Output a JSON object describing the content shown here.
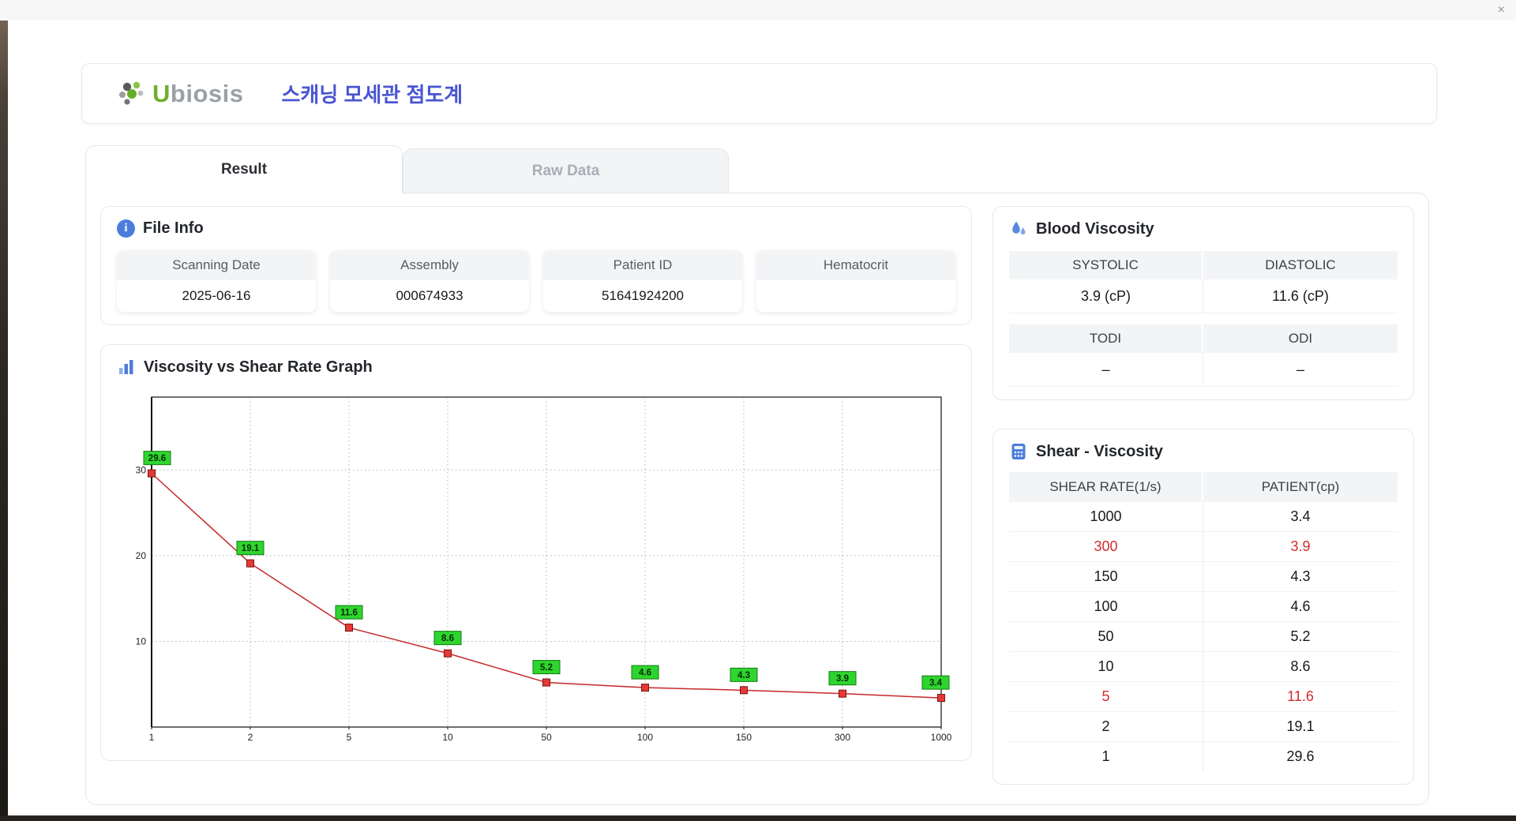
{
  "window": {
    "close_glyph": "×"
  },
  "header": {
    "brand_u": "U",
    "brand_rest": "biosis",
    "title": "스캐닝 모세관 점도계"
  },
  "tabs": [
    {
      "label": "Result",
      "active": true
    },
    {
      "label": "Raw Data",
      "active": false
    }
  ],
  "icons": {
    "info_glyph": "i"
  },
  "colors": {
    "accent_blue": "#4c7ddb",
    "title_blue": "#4a55d2",
    "brand_green": "#6faf2f",
    "highlight_red": "#d22c2c",
    "header_gray": "#f3f4f6"
  },
  "file_info": {
    "heading": "File Info",
    "fields": [
      {
        "label": "Scanning Date",
        "value": "2025-06-16"
      },
      {
        "label": "Assembly",
        "value": "000674933"
      },
      {
        "label": "Patient ID",
        "value": "51641924200"
      },
      {
        "label": "Hematocrit",
        "value": ""
      }
    ]
  },
  "blood_viscosity": {
    "heading": "Blood Viscosity",
    "rows": [
      {
        "cells": [
          {
            "label": "SYSTOLIC",
            "value": "3.9 (cP)"
          },
          {
            "label": "DIASTOLIC",
            "value": "11.6 (cP)"
          }
        ]
      },
      {
        "cells": [
          {
            "label": "TODI",
            "value": "–"
          },
          {
            "label": "ODI",
            "value": "–"
          }
        ]
      }
    ]
  },
  "graph": {
    "heading": "Viscosity vs Shear Rate Graph"
  },
  "chart_data": {
    "type": "line",
    "title": "",
    "xlabel": "",
    "ylabel": "",
    "categories": [
      "1",
      "2",
      "5",
      "10",
      "50",
      "100",
      "150",
      "300",
      "1000"
    ],
    "values": [
      29.6,
      19.1,
      11.6,
      8.6,
      5.2,
      4.6,
      4.3,
      3.9,
      3.4
    ],
    "ylim": [
      0,
      38.5
    ],
    "yticks": [
      10,
      20,
      30
    ],
    "x_scale": "category",
    "grid": "dotted",
    "legend": "none",
    "line_color": "#c62828",
    "marker": "square",
    "marker_color": "#e53935",
    "marker_edge": "#7a1212",
    "label_bg": "#2ed52e",
    "label_edge": "#157a15",
    "label_text": "#062c06"
  },
  "shear_viscosity": {
    "heading": "Shear - Viscosity",
    "columns": [
      "SHEAR RATE(1/s)",
      "PATIENT(cp)"
    ],
    "rows": [
      {
        "shear": "1000",
        "patient": "3.4",
        "highlight": false
      },
      {
        "shear": "300",
        "patient": "3.9",
        "highlight": true
      },
      {
        "shear": "150",
        "patient": "4.3",
        "highlight": false
      },
      {
        "shear": "100",
        "patient": "4.6",
        "highlight": false
      },
      {
        "shear": "50",
        "patient": "5.2",
        "highlight": false
      },
      {
        "shear": "10",
        "patient": "8.6",
        "highlight": false
      },
      {
        "shear": "5",
        "patient": "11.6",
        "highlight": true
      },
      {
        "shear": "2",
        "patient": "19.1",
        "highlight": false
      },
      {
        "shear": "1",
        "patient": "29.6",
        "highlight": false
      }
    ]
  }
}
